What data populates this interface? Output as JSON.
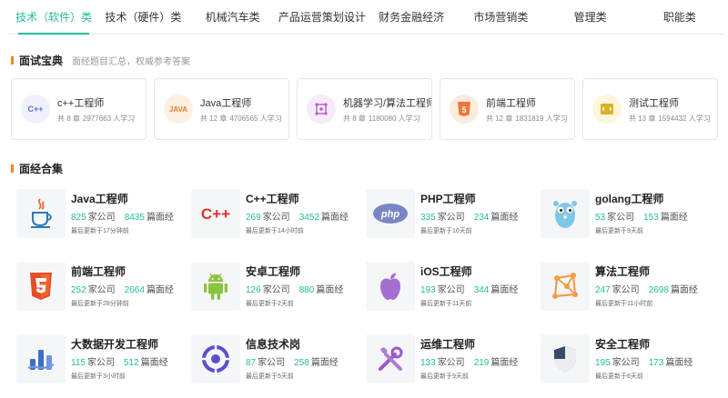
{
  "tabs": [
    {
      "label": "技术（软件）类",
      "active": true
    },
    {
      "label": "技术（硬件）类",
      "active": false
    },
    {
      "label": "机械汽车类",
      "active": false
    },
    {
      "label": "产品运营策划设计",
      "active": false
    },
    {
      "label": "财务金融经济",
      "active": false
    },
    {
      "label": "市场营销类",
      "active": false
    },
    {
      "label": "管理类",
      "active": false
    },
    {
      "label": "职能类",
      "active": false
    }
  ],
  "interview": {
    "title": "面试宝典",
    "subtitle": "面经题目汇总，权威参考答案",
    "cards": [
      {
        "name": "c++工程师",
        "chapters": "共 8 章",
        "learners": "2977663 人学习",
        "icon": "cpp-icon",
        "icon_text": "C++",
        "icon_bg": "#eef0fb",
        "icon_color": "#5b6bd8"
      },
      {
        "name": "Java工程师",
        "chapters": "共 12 章",
        "learners": "4706565 人学习",
        "icon": "java-icon",
        "icon_text": "JAVA",
        "icon_bg": "#fdf0e2",
        "icon_color": "#d9822b"
      },
      {
        "name": "机器学习/算法工程师",
        "chapters": "共 8 章",
        "learners": "1180080 人学习",
        "icon": "ml-icon",
        "icon_text": "",
        "icon_bg": "#f6ecf8",
        "icon_color": "#b45cc7"
      },
      {
        "name": "前端工程师",
        "chapters": "共 12 章",
        "learners": "1831819 人学习",
        "icon": "html5-icon",
        "icon_text": "5",
        "icon_bg": "#fdebe0",
        "icon_color": "#f0773a"
      },
      {
        "name": "测试工程师",
        "chapters": "共 13 章",
        "learners": "1594432 人学习",
        "icon": "test-icon",
        "icon_text": "",
        "icon_bg": "#fbf6dc",
        "icon_color": "#d6b324"
      }
    ]
  },
  "experience": {
    "title": "面经合集",
    "companies_unit": "家公司",
    "posts_unit": "篇面经",
    "jobs": [
      {
        "name": "Java工程师",
        "companies": "825",
        "posts": "8435",
        "updated": "最后更新于17分钟前",
        "icon": "java-cup-icon"
      },
      {
        "name": "C++工程师",
        "companies": "269",
        "posts": "3452",
        "updated": "最后更新于14小时前",
        "icon": "cpp-logo-icon"
      },
      {
        "name": "PHP工程师",
        "companies": "335",
        "posts": "234",
        "updated": "最后更新于10天前",
        "icon": "php-icon"
      },
      {
        "name": "golang工程师",
        "companies": "53",
        "posts": "153",
        "updated": "最后更新于9天前",
        "icon": "gopher-icon"
      },
      {
        "name": "前端工程师",
        "companies": "252",
        "posts": "2664",
        "updated": "最后更新于28分钟前",
        "icon": "html5-shield-icon"
      },
      {
        "name": "安卓工程师",
        "companies": "126",
        "posts": "880",
        "updated": "最后更新于2天前",
        "icon": "android-icon"
      },
      {
        "name": "iOS工程师",
        "companies": "193",
        "posts": "344",
        "updated": "最后更新于11天前",
        "icon": "apple-icon"
      },
      {
        "name": "算法工程师",
        "companies": "247",
        "posts": "2698",
        "updated": "最后更新于11小时前",
        "icon": "algorithm-icon"
      },
      {
        "name": "大数据开发工程师",
        "companies": "115",
        "posts": "512",
        "updated": "最后更新于3小时前",
        "icon": "bigdata-icon"
      },
      {
        "name": "信息技术岗",
        "companies": "87",
        "posts": "258",
        "updated": "最后更新于5天前",
        "icon": "it-icon"
      },
      {
        "name": "运维工程师",
        "companies": "133",
        "posts": "219",
        "updated": "最后更新于9天前",
        "icon": "tools-icon"
      },
      {
        "name": "安全工程师",
        "companies": "195",
        "posts": "173",
        "updated": "最后更新于6天前",
        "icon": "security-shield-icon"
      }
    ]
  },
  "colors": {
    "accent": "#25bb9b",
    "section_marker": "#f58220"
  }
}
